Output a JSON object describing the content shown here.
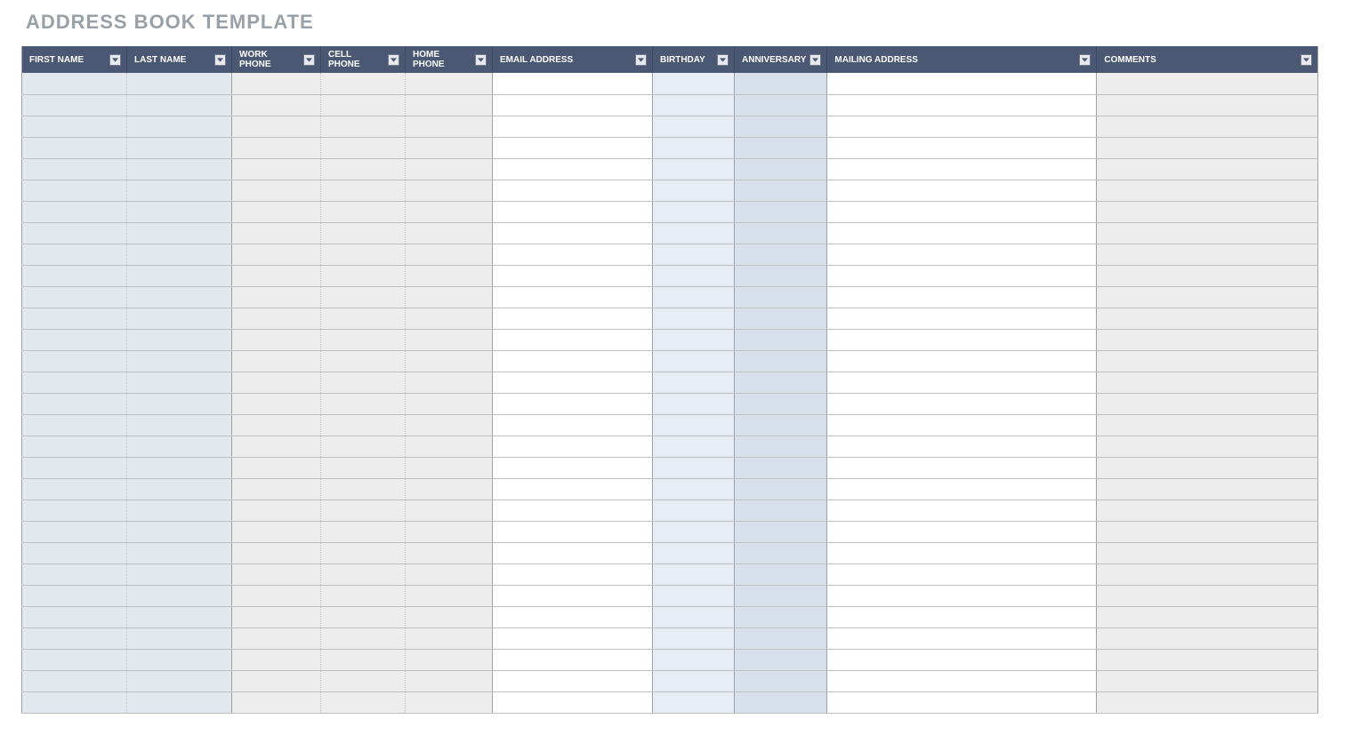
{
  "title": "ADDRESS BOOK TEMPLATE",
  "columns": [
    {
      "key": "first_name",
      "label": "FIRST NAME",
      "cls": "c-first",
      "fill": "fill-blue"
    },
    {
      "key": "last_name",
      "label": "LAST NAME",
      "cls": "c-last",
      "fill": "fill-blue"
    },
    {
      "key": "work_phone",
      "label": "WORK\nPHONE",
      "cls": "c-work",
      "fill": "fill-gray"
    },
    {
      "key": "cell_phone",
      "label": "CELL\nPHONE",
      "cls": "c-cell",
      "fill": "fill-gray"
    },
    {
      "key": "home_phone",
      "label": "HOME\nPHONE",
      "cls": "c-home",
      "fill": "fill-gray"
    },
    {
      "key": "email",
      "label": "EMAIL ADDRESS",
      "cls": "c-email",
      "fill": "fill-white"
    },
    {
      "key": "birthday",
      "label": "BIRTHDAY",
      "cls": "c-bday",
      "fill": "fill-ltblue"
    },
    {
      "key": "anniversary",
      "label": "ANNIVERSARY",
      "cls": "c-anniv",
      "fill": "fill-dblue"
    },
    {
      "key": "mailing",
      "label": "MAILING ADDRESS",
      "cls": "c-mail",
      "fill": "fill-white"
    },
    {
      "key": "comments",
      "label": "COMMENTS",
      "cls": "c-comm",
      "fill": "fill-gray"
    }
  ],
  "rows": [
    {
      "first_name": "",
      "last_name": "",
      "work_phone": "",
      "cell_phone": "",
      "home_phone": "",
      "email": "",
      "birthday": "",
      "anniversary": "",
      "mailing": "",
      "comments": ""
    },
    {
      "first_name": "",
      "last_name": "",
      "work_phone": "",
      "cell_phone": "",
      "home_phone": "",
      "email": "",
      "birthday": "",
      "anniversary": "",
      "mailing": "",
      "comments": ""
    },
    {
      "first_name": "",
      "last_name": "",
      "work_phone": "",
      "cell_phone": "",
      "home_phone": "",
      "email": "",
      "birthday": "",
      "anniversary": "",
      "mailing": "",
      "comments": ""
    },
    {
      "first_name": "",
      "last_name": "",
      "work_phone": "",
      "cell_phone": "",
      "home_phone": "",
      "email": "",
      "birthday": "",
      "anniversary": "",
      "mailing": "",
      "comments": ""
    },
    {
      "first_name": "",
      "last_name": "",
      "work_phone": "",
      "cell_phone": "",
      "home_phone": "",
      "email": "",
      "birthday": "",
      "anniversary": "",
      "mailing": "",
      "comments": ""
    },
    {
      "first_name": "",
      "last_name": "",
      "work_phone": "",
      "cell_phone": "",
      "home_phone": "",
      "email": "",
      "birthday": "",
      "anniversary": "",
      "mailing": "",
      "comments": ""
    },
    {
      "first_name": "",
      "last_name": "",
      "work_phone": "",
      "cell_phone": "",
      "home_phone": "",
      "email": "",
      "birthday": "",
      "anniversary": "",
      "mailing": "",
      "comments": ""
    },
    {
      "first_name": "",
      "last_name": "",
      "work_phone": "",
      "cell_phone": "",
      "home_phone": "",
      "email": "",
      "birthday": "",
      "anniversary": "",
      "mailing": "",
      "comments": ""
    },
    {
      "first_name": "",
      "last_name": "",
      "work_phone": "",
      "cell_phone": "",
      "home_phone": "",
      "email": "",
      "birthday": "",
      "anniversary": "",
      "mailing": "",
      "comments": ""
    },
    {
      "first_name": "",
      "last_name": "",
      "work_phone": "",
      "cell_phone": "",
      "home_phone": "",
      "email": "",
      "birthday": "",
      "anniversary": "",
      "mailing": "",
      "comments": ""
    },
    {
      "first_name": "",
      "last_name": "",
      "work_phone": "",
      "cell_phone": "",
      "home_phone": "",
      "email": "",
      "birthday": "",
      "anniversary": "",
      "mailing": "",
      "comments": ""
    },
    {
      "first_name": "",
      "last_name": "",
      "work_phone": "",
      "cell_phone": "",
      "home_phone": "",
      "email": "",
      "birthday": "",
      "anniversary": "",
      "mailing": "",
      "comments": ""
    },
    {
      "first_name": "",
      "last_name": "",
      "work_phone": "",
      "cell_phone": "",
      "home_phone": "",
      "email": "",
      "birthday": "",
      "anniversary": "",
      "mailing": "",
      "comments": ""
    },
    {
      "first_name": "",
      "last_name": "",
      "work_phone": "",
      "cell_phone": "",
      "home_phone": "",
      "email": "",
      "birthday": "",
      "anniversary": "",
      "mailing": "",
      "comments": ""
    },
    {
      "first_name": "",
      "last_name": "",
      "work_phone": "",
      "cell_phone": "",
      "home_phone": "",
      "email": "",
      "birthday": "",
      "anniversary": "",
      "mailing": "",
      "comments": ""
    },
    {
      "first_name": "",
      "last_name": "",
      "work_phone": "",
      "cell_phone": "",
      "home_phone": "",
      "email": "",
      "birthday": "",
      "anniversary": "",
      "mailing": "",
      "comments": ""
    },
    {
      "first_name": "",
      "last_name": "",
      "work_phone": "",
      "cell_phone": "",
      "home_phone": "",
      "email": "",
      "birthday": "",
      "anniversary": "",
      "mailing": "",
      "comments": ""
    },
    {
      "first_name": "",
      "last_name": "",
      "work_phone": "",
      "cell_phone": "",
      "home_phone": "",
      "email": "",
      "birthday": "",
      "anniversary": "",
      "mailing": "",
      "comments": ""
    },
    {
      "first_name": "",
      "last_name": "",
      "work_phone": "",
      "cell_phone": "",
      "home_phone": "",
      "email": "",
      "birthday": "",
      "anniversary": "",
      "mailing": "",
      "comments": ""
    },
    {
      "first_name": "",
      "last_name": "",
      "work_phone": "",
      "cell_phone": "",
      "home_phone": "",
      "email": "",
      "birthday": "",
      "anniversary": "",
      "mailing": "",
      "comments": ""
    },
    {
      "first_name": "",
      "last_name": "",
      "work_phone": "",
      "cell_phone": "",
      "home_phone": "",
      "email": "",
      "birthday": "",
      "anniversary": "",
      "mailing": "",
      "comments": ""
    },
    {
      "first_name": "",
      "last_name": "",
      "work_phone": "",
      "cell_phone": "",
      "home_phone": "",
      "email": "",
      "birthday": "",
      "anniversary": "",
      "mailing": "",
      "comments": ""
    },
    {
      "first_name": "",
      "last_name": "",
      "work_phone": "",
      "cell_phone": "",
      "home_phone": "",
      "email": "",
      "birthday": "",
      "anniversary": "",
      "mailing": "",
      "comments": ""
    },
    {
      "first_name": "",
      "last_name": "",
      "work_phone": "",
      "cell_phone": "",
      "home_phone": "",
      "email": "",
      "birthday": "",
      "anniversary": "",
      "mailing": "",
      "comments": ""
    },
    {
      "first_name": "",
      "last_name": "",
      "work_phone": "",
      "cell_phone": "",
      "home_phone": "",
      "email": "",
      "birthday": "",
      "anniversary": "",
      "mailing": "",
      "comments": ""
    },
    {
      "first_name": "",
      "last_name": "",
      "work_phone": "",
      "cell_phone": "",
      "home_phone": "",
      "email": "",
      "birthday": "",
      "anniversary": "",
      "mailing": "",
      "comments": ""
    },
    {
      "first_name": "",
      "last_name": "",
      "work_phone": "",
      "cell_phone": "",
      "home_phone": "",
      "email": "",
      "birthday": "",
      "anniversary": "",
      "mailing": "",
      "comments": ""
    },
    {
      "first_name": "",
      "last_name": "",
      "work_phone": "",
      "cell_phone": "",
      "home_phone": "",
      "email": "",
      "birthday": "",
      "anniversary": "",
      "mailing": "",
      "comments": ""
    },
    {
      "first_name": "",
      "last_name": "",
      "work_phone": "",
      "cell_phone": "",
      "home_phone": "",
      "email": "",
      "birthday": "",
      "anniversary": "",
      "mailing": "",
      "comments": ""
    },
    {
      "first_name": "",
      "last_name": "",
      "work_phone": "",
      "cell_phone": "",
      "home_phone": "",
      "email": "",
      "birthday": "",
      "anniversary": "",
      "mailing": "",
      "comments": ""
    }
  ]
}
